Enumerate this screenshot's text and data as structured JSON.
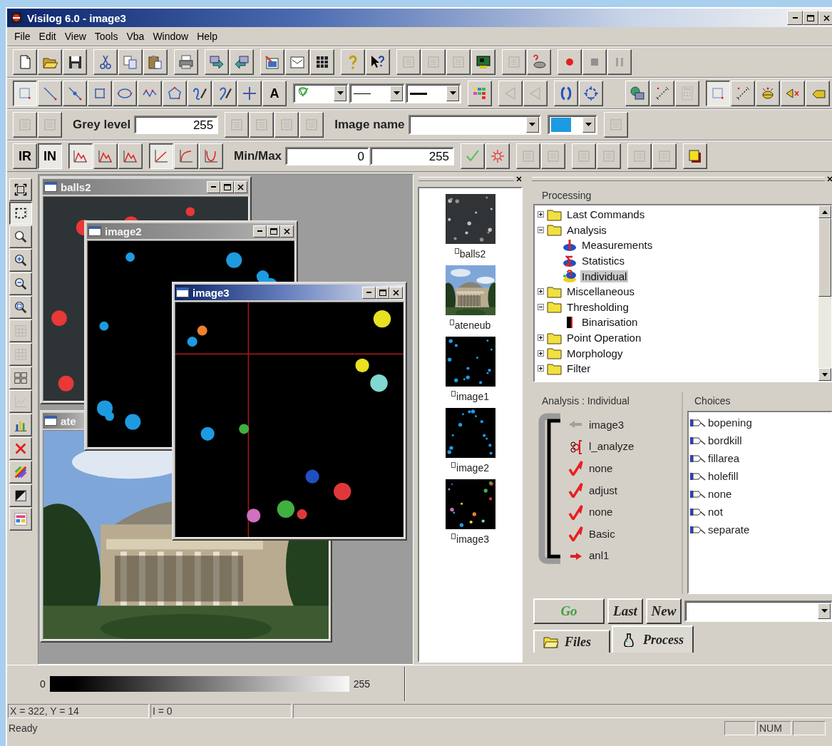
{
  "window": {
    "title": "Visilog 6.0 - image3"
  },
  "menu": [
    "File",
    "Edit",
    "View",
    "Tools",
    "Vba",
    "Window",
    "Help"
  ],
  "toolbars": [
    {
      "groups": [
        [
          {
            "kind": "icon",
            "pressed": false,
            "disabled": false
          },
          {
            "kind": "icon",
            "pressed": false,
            "disabled": false
          },
          {
            "kind": "icon",
            "pressed": false,
            "disabled": false
          }
        ],
        [
          {
            "kind": "icon",
            "pressed": false,
            "disabled": false
          },
          {
            "kind": "icon",
            "pressed": false,
            "disabled": false
          },
          {
            "kind": "icon",
            "pressed": false,
            "disabled": false
          }
        ],
        [
          {
            "kind": "icon",
            "pressed": false,
            "disabled": false
          }
        ],
        [
          {
            "kind": "icon",
            "pressed": false,
            "disabled": false
          },
          {
            "kind": "icon",
            "pressed": false,
            "disabled": false
          }
        ],
        [
          {
            "kind": "icon",
            "pressed": false,
            "disabled": false
          },
          {
            "kind": "icon",
            "pressed": false,
            "disabled": false
          },
          {
            "kind": "icon",
            "pressed": false,
            "disabled": false
          }
        ],
        [
          {
            "kind": "icon",
            "pressed": false,
            "disabled": false
          },
          {
            "kind": "icon",
            "pressed": false,
            "disabled": false
          }
        ],
        [
          {
            "kind": "icon",
            "pressed": false,
            "disabled": true
          },
          {
            "kind": "icon",
            "pressed": false,
            "disabled": true
          },
          {
            "kind": "icon",
            "pressed": false,
            "disabled": true
          },
          {
            "kind": "icon",
            "pressed": false,
            "disabled": false
          }
        ],
        [
          {
            "kind": "icon",
            "pressed": false,
            "disabled": true
          },
          {
            "kind": "icon",
            "pressed": false,
            "disabled": false
          }
        ],
        [
          {
            "kind": "icon",
            "pressed": false,
            "disabled": false
          },
          {
            "kind": "icon",
            "pressed": false,
            "disabled": false
          },
          {
            "kind": "icon",
            "pressed": false,
            "disabled": false
          }
        ]
      ]
    },
    {
      "groups": [
        [
          {
            "kind": "icon",
            "pressed": true,
            "disabled": false
          },
          {
            "kind": "icon",
            "pressed": false,
            "disabled": false
          },
          {
            "kind": "icon",
            "pressed": false,
            "disabled": false
          },
          {
            "kind": "icon",
            "pressed": false,
            "disabled": false
          },
          {
            "kind": "icon",
            "pressed": false,
            "disabled": false
          },
          {
            "kind": "icon",
            "pressed": false,
            "disabled": false
          },
          {
            "kind": "icon",
            "pressed": false,
            "disabled": false
          },
          {
            "kind": "icon",
            "pressed": false,
            "disabled": false
          },
          {
            "kind": "icon",
            "pressed": false,
            "disabled": false
          },
          {
            "kind": "icon",
            "pressed": false,
            "disabled": false
          },
          {
            "kind": "text",
            "label": "A",
            "pressed": false,
            "disabled": false
          }
        ],
        [
          {
            "kind": "icon_combo"
          },
          {
            "kind": "icon_combo"
          },
          {
            "kind": "icon_combo"
          }
        ],
        [
          {
            "kind": "icon",
            "pressed": false,
            "disabled": false
          }
        ],
        [
          {
            "kind": "icon",
            "pressed": false,
            "disabled": true
          },
          {
            "kind": "icon",
            "pressed": false,
            "disabled": true
          }
        ],
        [
          {
            "kind": "icon",
            "pressed": false,
            "disabled": false
          },
          {
            "kind": "icon",
            "pressed": false,
            "disabled": false
          }
        ],
        [
          {
            "kind": "spacer"
          }
        ],
        [
          {
            "kind": "icon",
            "pressed": false,
            "disabled": false
          },
          {
            "kind": "icon",
            "pressed": false,
            "disabled": false
          },
          {
            "kind": "icon",
            "pressed": false,
            "disabled": true
          }
        ],
        [
          {
            "kind": "icon",
            "pressed": true,
            "disabled": false
          },
          {
            "kind": "icon",
            "pressed": false,
            "disabled": false
          },
          {
            "kind": "icon",
            "pressed": false,
            "disabled": false
          },
          {
            "kind": "icon",
            "pressed": false,
            "disabled": false
          },
          {
            "kind": "icon",
            "pressed": false,
            "disabled": false
          }
        ]
      ]
    },
    {
      "groups": [
        [
          {
            "kind": "icon",
            "pressed": false,
            "disabled": true
          },
          {
            "kind": "icon",
            "pressed": false,
            "disabled": true
          }
        ],
        [
          {
            "kind": "label",
            "label": "Grey level"
          },
          {
            "kind": "field",
            "value": "255"
          }
        ],
        [
          {
            "kind": "icon",
            "pressed": false,
            "disabled": true
          },
          {
            "kind": "icon",
            "pressed": false,
            "disabled": true
          },
          {
            "kind": "icon",
            "pressed": false,
            "disabled": true
          },
          {
            "kind": "icon",
            "pressed": false,
            "disabled": true
          }
        ],
        [
          {
            "kind": "label",
            "label": "Image name"
          },
          {
            "kind": "combo"
          }
        ],
        [
          {
            "kind": "color_combo",
            "color": "#1e9be0"
          }
        ],
        [
          {
            "kind": "icon",
            "pressed": false,
            "disabled": true
          }
        ]
      ]
    },
    {
      "groups": [
        [
          {
            "kind": "text",
            "label": "IR",
            "pressed": false,
            "disabled": false
          },
          {
            "kind": "text",
            "label": "IN",
            "pressed": true,
            "disabled": false
          }
        ],
        [
          {
            "kind": "icon",
            "pressed": true,
            "disabled": false
          },
          {
            "kind": "icon",
            "pressed": false,
            "disabled": false
          },
          {
            "kind": "icon",
            "pressed": false,
            "disabled": false
          }
        ],
        [
          {
            "kind": "icon",
            "pressed": true,
            "disabled": false
          },
          {
            "kind": "icon",
            "pressed": false,
            "disabled": false
          },
          {
            "kind": "icon",
            "pressed": false,
            "disabled": false
          }
        ],
        [
          {
            "kind": "label",
            "label": "Min/Max"
          },
          {
            "kind": "field",
            "value": "0"
          },
          {
            "kind": "field",
            "value": "255"
          }
        ],
        [
          {
            "kind": "icon",
            "pressed": false,
            "disabled": false
          },
          {
            "kind": "icon",
            "pressed": false,
            "disabled": false
          }
        ],
        [
          {
            "kind": "icon",
            "pressed": false,
            "disabled": true
          },
          {
            "kind": "icon",
            "pressed": false,
            "disabled": true
          }
        ],
        [
          {
            "kind": "icon",
            "pressed": false,
            "disabled": true
          },
          {
            "kind": "icon",
            "pressed": false,
            "disabled": true
          }
        ],
        [
          {
            "kind": "icon",
            "pressed": false,
            "disabled": true
          },
          {
            "kind": "icon",
            "pressed": false,
            "disabled": true
          }
        ],
        [
          {
            "kind": "icon",
            "pressed": false,
            "disabled": false
          }
        ]
      ]
    }
  ],
  "side_toolbar": [
    {
      "pressed": false,
      "disabled": false
    },
    {
      "pressed": true,
      "disabled": false
    },
    {
      "pressed": false,
      "disabled": false
    },
    {
      "pressed": false,
      "disabled": false
    },
    {
      "pressed": false,
      "disabled": false
    },
    {
      "pressed": false,
      "disabled": false
    },
    {
      "pressed": false,
      "disabled": true
    },
    {
      "pressed": false,
      "disabled": true
    },
    {
      "pressed": false,
      "disabled": false
    },
    {
      "pressed": false,
      "disabled": true
    },
    {
      "pressed": false,
      "disabled": false
    },
    {
      "pressed": false,
      "disabled": false
    },
    {
      "pressed": false,
      "disabled": false
    },
    {
      "pressed": false,
      "disabled": false
    },
    {
      "pressed": false,
      "disabled": false
    }
  ],
  "documents": [
    {
      "title": "balls2",
      "active": false
    },
    {
      "title": "ate",
      "active": false
    },
    {
      "title": "image2",
      "active": false
    },
    {
      "title": "image3",
      "active": true
    }
  ],
  "thumbnails": [
    {
      "label": "balls2"
    },
    {
      "label": "ateneub"
    },
    {
      "label": "image1"
    },
    {
      "label": "image2"
    },
    {
      "label": "image3"
    }
  ],
  "processing": {
    "title": "Processing",
    "tree": [
      {
        "label": "Last Commands",
        "kind": "folder",
        "expanded": false,
        "selected": false
      },
      {
        "label": "Analysis",
        "kind": "folder",
        "expanded": true,
        "selected": false,
        "children": [
          {
            "label": "Measurements",
            "kind": "measure",
            "selected": false
          },
          {
            "label": "Statistics",
            "kind": "stats",
            "selected": false
          },
          {
            "label": "Individual",
            "kind": "individual",
            "selected": true
          }
        ]
      },
      {
        "label": "Miscellaneous",
        "kind": "folder",
        "expanded": false,
        "selected": false
      },
      {
        "label": "Thresholding",
        "kind": "folder",
        "expanded": true,
        "selected": false,
        "children": [
          {
            "label": "Binarisation",
            "kind": "binarise",
            "selected": false
          }
        ]
      },
      {
        "label": "Point Operation",
        "kind": "folder",
        "expanded": false,
        "selected": false
      },
      {
        "label": "Morphology",
        "kind": "folder",
        "expanded": false,
        "selected": false
      },
      {
        "label": "Filter",
        "kind": "folder",
        "expanded": false,
        "selected": false
      }
    ],
    "operation_title": "Analysis : Individual",
    "parameters": [
      {
        "kind": "input",
        "label": "image3"
      },
      {
        "kind": "operator",
        "label": "l_analyze"
      },
      {
        "kind": "check",
        "label": "none"
      },
      {
        "kind": "check",
        "label": "adjust"
      },
      {
        "kind": "check",
        "label": "none"
      },
      {
        "kind": "check",
        "label": "Basic"
      },
      {
        "kind": "output",
        "label": "anl1"
      }
    ],
    "choices_title": "Choices",
    "choices": [
      "bopening",
      "bordkill",
      "fillarea",
      "holefill",
      "none",
      "not",
      "separate"
    ],
    "buttons": [
      {
        "kind": "go",
        "label": "Go"
      },
      {
        "kind": "plain",
        "label": "Last"
      },
      {
        "kind": "plain",
        "label": "New"
      }
    ],
    "tabs": [
      {
        "label": "Files",
        "kind": "files",
        "selected": false
      },
      {
        "label": "Process",
        "kind": "process",
        "selected": true
      }
    ]
  },
  "gradient": {
    "min": "0",
    "max": "255"
  },
  "status": {
    "position": "X = 322, Y = 14",
    "intensity": "I = 0",
    "message": "Ready",
    "num": "NUM"
  }
}
